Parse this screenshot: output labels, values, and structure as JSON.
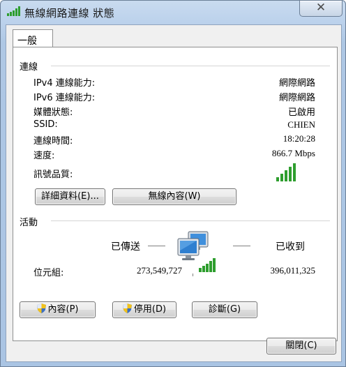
{
  "window": {
    "title": "無線網路連線 狀態",
    "close_glyph": "✕"
  },
  "tabs": [
    {
      "label": "一般"
    }
  ],
  "connection": {
    "heading": "連線",
    "rows": [
      {
        "label": "IPv4 連線能力:",
        "value": "網際網路"
      },
      {
        "label": "IPv6 連線能力:",
        "value": "網際網路"
      },
      {
        "label": "媒體狀態:",
        "value": "已啟用"
      },
      {
        "label": "SSID:",
        "value": "CHIEN"
      },
      {
        "label": "連線時間:",
        "value": "18:20:28"
      },
      {
        "label": "速度:",
        "value": "866.7 Mbps"
      }
    ],
    "signal_label": "訊號品質:",
    "signal_bars": 5,
    "signal_color": "#2e9e2e",
    "details_button": "詳細資料(E)...",
    "wireless_props_button": "無線內容(W)"
  },
  "activity": {
    "heading": "活動",
    "sent_label": "已傳送",
    "received_label": "已收到",
    "bytes_label": "位元組:",
    "bytes_sent": "273,549,727",
    "bytes_received": "396,011,325"
  },
  "buttons": {
    "properties": "內容(P)",
    "disable": "停用(D)",
    "diagnose": "診斷(G)",
    "close": "關閉(C)"
  }
}
